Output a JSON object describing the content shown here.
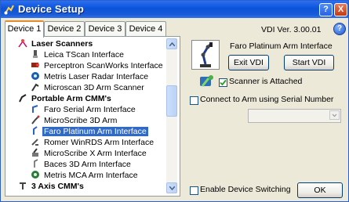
{
  "window": {
    "title": "Device Setup",
    "help_glyph": "?",
    "close_glyph": "X"
  },
  "tabs": [
    {
      "label": "Device 1",
      "active": true
    },
    {
      "label": "Device 2",
      "active": false
    },
    {
      "label": "Device 3",
      "active": false
    },
    {
      "label": "Device 4",
      "active": false
    }
  ],
  "tree": {
    "items": [
      {
        "label": "Laser Scanners",
        "type": "category",
        "icon": "laser-scanner-category-icon"
      },
      {
        "label": "Leica TScan Interface",
        "type": "item",
        "icon": "leica-tscan-icon"
      },
      {
        "label": "Perceptron ScanWorks Interface",
        "type": "item",
        "icon": "perceptron-icon"
      },
      {
        "label": "Metris Laser Radar Interface",
        "type": "item",
        "icon": "laser-radar-icon"
      },
      {
        "label": "Microscan 3D Arm Scanner",
        "type": "item",
        "icon": "microscan-icon"
      },
      {
        "label": "Portable Arm CMM's",
        "type": "category",
        "icon": "portable-arm-category-icon"
      },
      {
        "label": "Faro Serial Arm Interface",
        "type": "item",
        "icon": "faro-serial-arm-icon"
      },
      {
        "label": "MicroScribe 3D Arm",
        "type": "item",
        "icon": "microscribe-icon"
      },
      {
        "label": "Faro Platinum Arm Interface",
        "type": "item",
        "icon": "faro-platinum-arm-icon",
        "selected": true
      },
      {
        "label": "Romer WinRDS Arm Interface",
        "type": "item",
        "icon": "romer-arm-icon"
      },
      {
        "label": "MicroScribe X Arm Interface",
        "type": "item",
        "icon": "microscribe-x-icon"
      },
      {
        "label": "Baces 3D Arm Interface",
        "type": "item",
        "icon": "baces-arm-icon"
      },
      {
        "label": "Metris MCA Arm Interface",
        "type": "item",
        "icon": "metris-mca-icon"
      },
      {
        "label": "3 Axis CMM's",
        "type": "category",
        "icon": "cmm-category-icon"
      }
    ]
  },
  "right_panel": {
    "version": "VDI Ver. 3.00.01",
    "help_glyph": "?",
    "device_name": "Faro Platinum Arm Interface",
    "exit_label": "Exit VDI",
    "start_label": "Start VDI",
    "scanner_attached_label": "Scanner is Attached",
    "scanner_attached_checked": true,
    "serial_label": "Connect to Arm using Serial Number",
    "serial_checked": false,
    "serial_value": "",
    "device_switching_label": "Enable Device Switching",
    "device_switching_checked": false,
    "ok_label": "OK"
  },
  "colors": {
    "title_bar": "#0a53d9",
    "selection": "#316ac5",
    "tab_highlight": "#e68b2c"
  }
}
